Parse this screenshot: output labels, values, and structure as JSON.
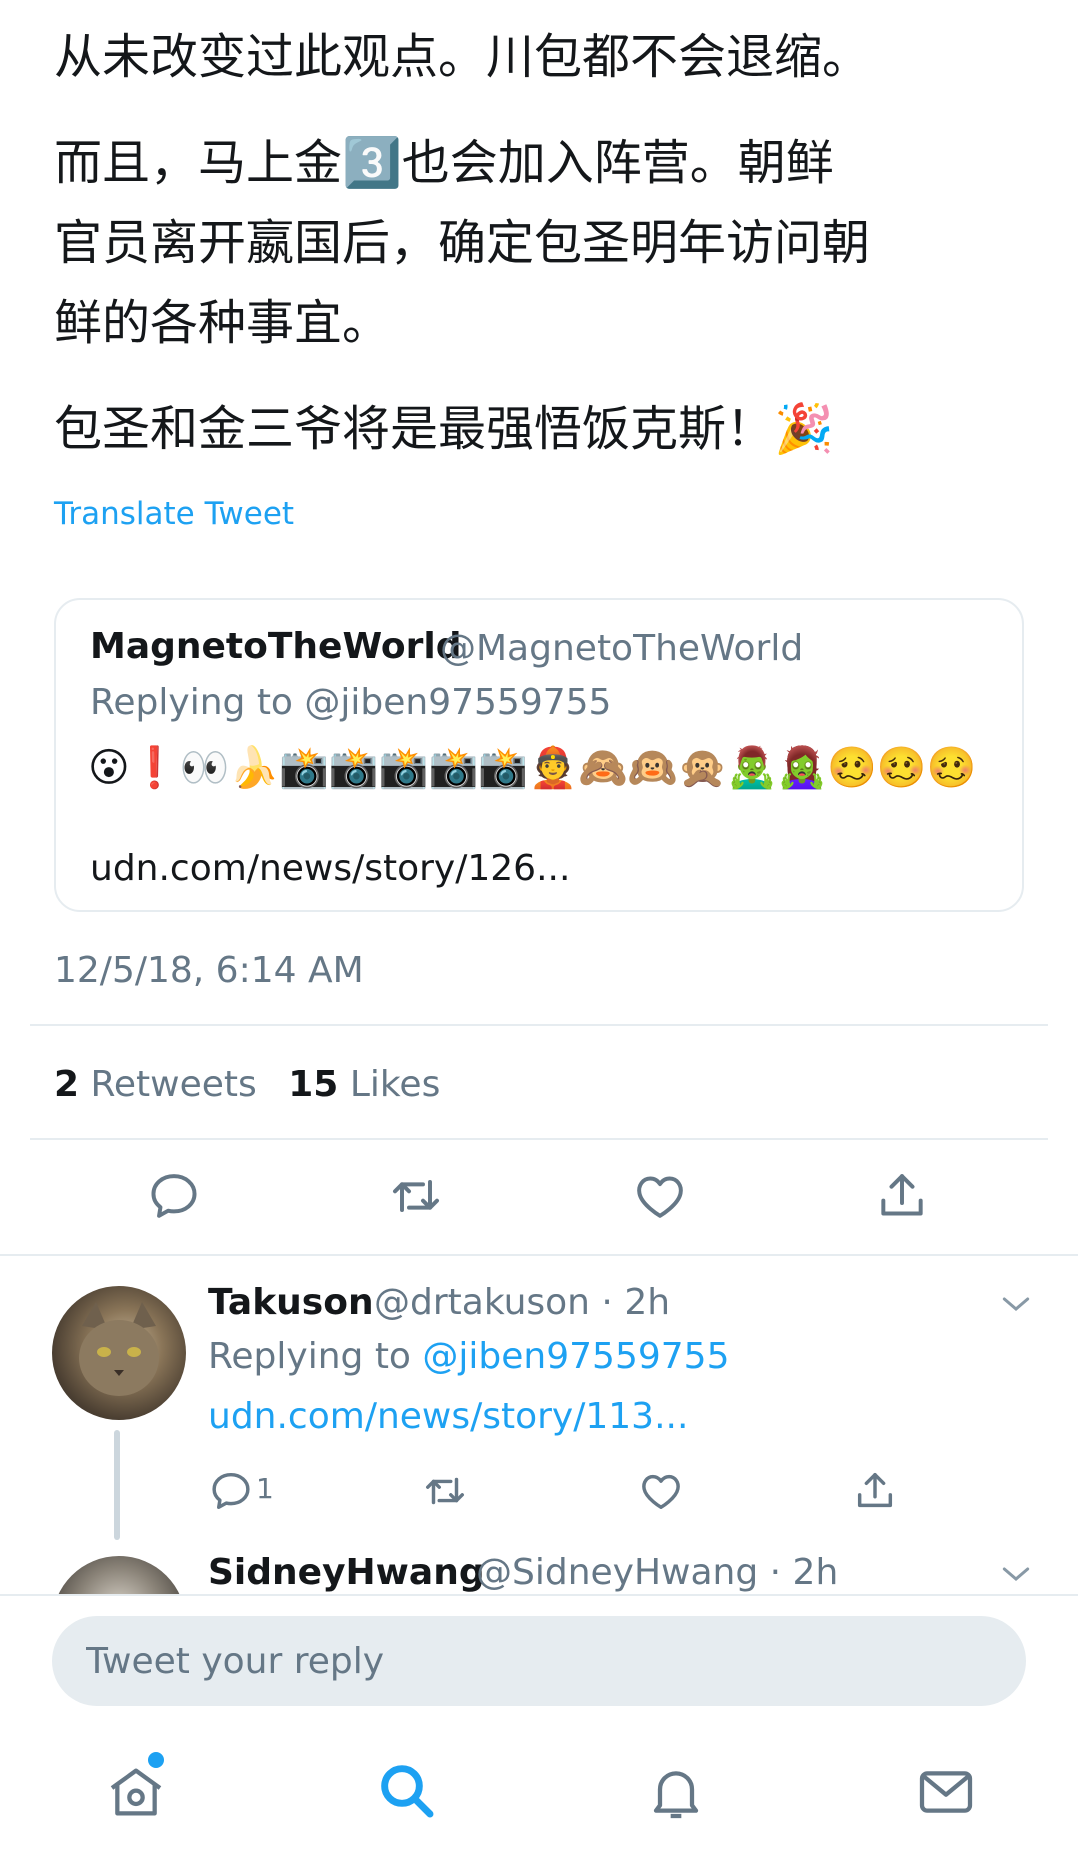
{
  "colors": {
    "accent": "#1da1f2",
    "text": "#14171a",
    "muted": "#657786",
    "divider": "#e6ecf0"
  },
  "tweet": {
    "lines": [
      "从未改变过此观点。川包都不会退缩。",
      "而且，马上金3️⃣也会加入阵营。朝鲜",
      "官员离开嬴国后，确定包圣明年访问朝",
      "鲜的各种事宜。",
      "包圣和金三爷将是最强悟饭克斯！🎉"
    ],
    "translate_label": "Translate Tweet",
    "timestamp": "12/5/18, 6:14 AM",
    "retweets_count": "2",
    "retweets_label": "Retweets",
    "likes_count": "15",
    "likes_label": "Likes"
  },
  "quoted_tweet": {
    "name": "MagnetoTheWorld",
    "handle": "@MagnetoTheWorld",
    "replying_to": "Replying to @jiben97559755",
    "emojis": "😮❗👀🍌📸📸📸📸📸👲🙈🙉🙊🧟‍♂️🧟‍♀️🥴🥴🥴",
    "link": "udn.com/news/story/126..."
  },
  "actions": {
    "reply_icon": "reply-icon",
    "retweet_icon": "retweet-icon",
    "like_icon": "heart-icon",
    "share_icon": "share-icon"
  },
  "replies": [
    {
      "name": "Takuson",
      "handle_time": "@drtakuson · 2h",
      "replying_prefix": "Replying to",
      "replying_handle": "@jiben97559755",
      "link": "udn.com/news/story/113...",
      "reply_count": "1"
    },
    {
      "name": "SidneyHwang",
      "handle_time": "@SidneyHwang · 2h"
    }
  ],
  "reply_input": {
    "placeholder": "Tweet your reply"
  },
  "bottom_nav": [
    "home-icon",
    "search-icon",
    "notifications-icon",
    "messages-icon"
  ]
}
